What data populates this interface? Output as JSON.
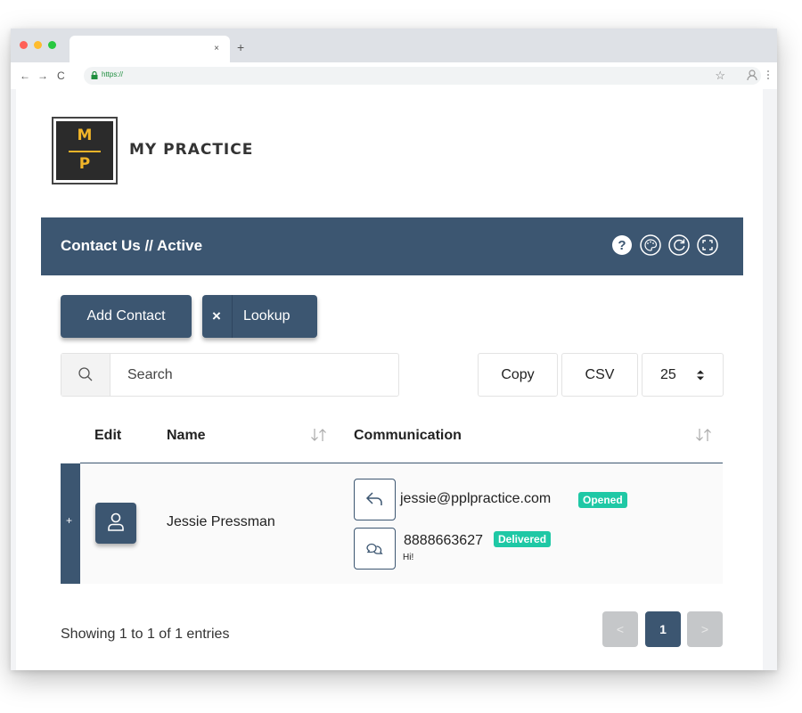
{
  "browser": {
    "url": "https://",
    "tab_close": "×",
    "new_tab": "+",
    "back": "←",
    "forward": "→",
    "reload": "C",
    "bookmark": "☆",
    "profile_icon": "profile-icon"
  },
  "logo": {
    "top_letter": "M",
    "bottom_letter": "P"
  },
  "brand": {
    "name": "MY PRACTICE"
  },
  "card": {
    "title": "Contact Us // Active",
    "header_icons": [
      "help-icon",
      "palette-icon",
      "refresh-icon",
      "fullscreen-icon"
    ]
  },
  "actions": {
    "add_contact": "Add Contact",
    "lookup_x": "×",
    "lookup": "Lookup"
  },
  "search": {
    "placeholder": "Search"
  },
  "toolbar": {
    "copy": "Copy",
    "csv": "CSV",
    "page_size": "25"
  },
  "table": {
    "columns": {
      "edit": "Edit",
      "name": "Name",
      "communication": "Communication"
    },
    "rows": [
      {
        "expand": "+",
        "name": "Jessie Pressman",
        "email": "jessie@pplpractice.com",
        "email_status": "Opened",
        "phone": "8888663627",
        "phone_status": "Delivered",
        "message": "Hi!"
      }
    ]
  },
  "footer": {
    "info": "Showing 1 to 1 of 1 entries",
    "prev": "<",
    "current_page": "1",
    "next": ">"
  },
  "colors": {
    "primary": "#3c5671",
    "badge": "#1fc8a5",
    "logo_gold": "#f0b429",
    "logo_dark": "#2b2b2b"
  }
}
